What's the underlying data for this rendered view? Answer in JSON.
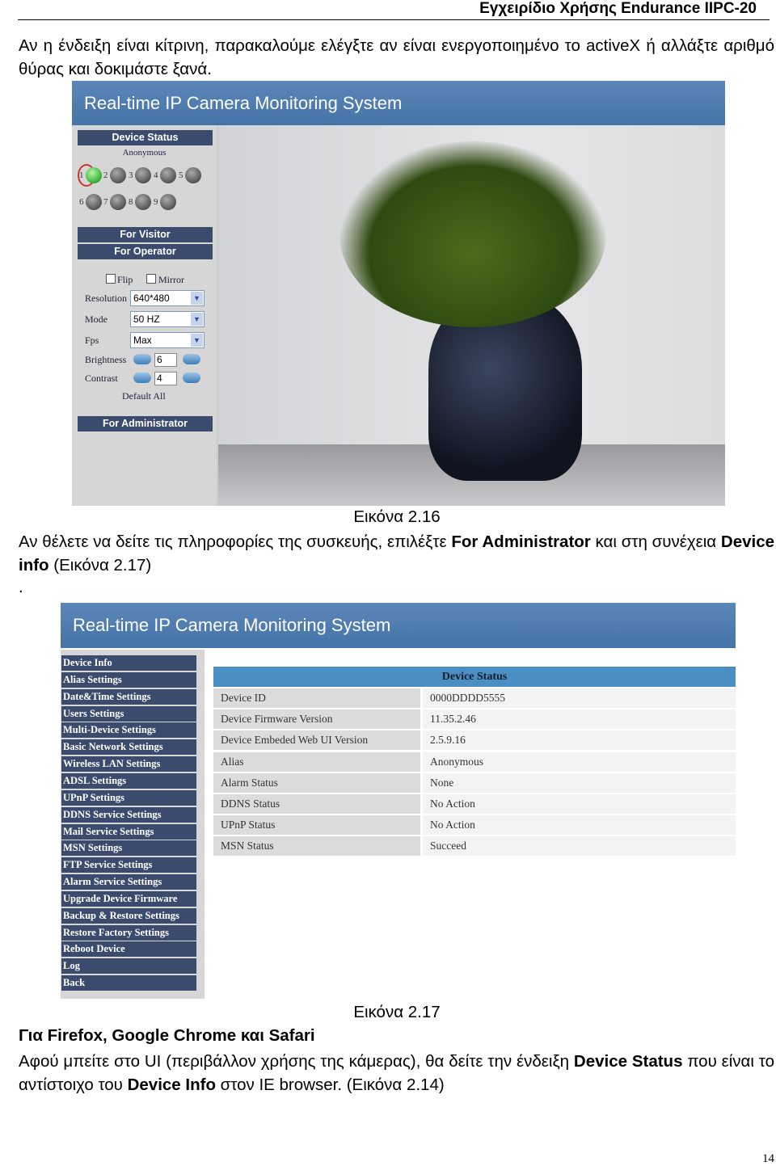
{
  "header": {
    "title": "Εγχειρίδιο Χρήσης Endurance IIPC-20"
  },
  "para1": "Αν η ένδειξη είναι κίτρινη, παρακαλούμε ελέγξτε αν είναι ενεργοποιημένο το activeX ή αλλάξτε αριθμό θύρας και δοκιμάστε ξανά.",
  "fig1": {
    "title": "Real-time IP Camera Monitoring System",
    "device_status": "Device Status",
    "user": "Anonymous",
    "leds": [
      "1",
      "2",
      "3",
      "4",
      "5",
      "6",
      "7",
      "8",
      "9"
    ],
    "active_led": "1",
    "for_visitor": "For Visitor",
    "for_operator": "For Operator",
    "flip": "Flip",
    "mirror": "Mirror",
    "resolution_label": "Resolution",
    "resolution": "640*480",
    "mode_label": "Mode",
    "mode": "50 HZ",
    "fps_label": "Fps",
    "fps": "Max",
    "brightness_label": "Brightness",
    "brightness": "6",
    "contrast_label": "Contrast",
    "contrast": "4",
    "default_all": "Default All",
    "for_administrator": "For Administrator",
    "caption": "Εικόνα 2.16"
  },
  "para2": {
    "a": "Αν θέλετε να δείτε τις πληροφορίες της συσκευής, επιλέξτε ",
    "b": "For Administrator",
    "c": " και στη συνέχεια ",
    "d": "Device info",
    "e": " (Εικόνα 2.17)",
    "dot": "."
  },
  "fig2": {
    "title": "Real-time IP Camera Monitoring System",
    "menu": [
      "Device Info",
      "Alias Settings",
      "Date&Time Settings",
      "Users Settings",
      "Multi-Device Settings",
      "Basic Network Settings",
      "Wireless LAN Settings",
      "ADSL Settings",
      "UPnP Settings",
      "DDNS Service Settings",
      "Mail Service Settings",
      "MSN Settings",
      "FTP Service Settings",
      "Alarm Service Settings",
      "Upgrade Device Firmware",
      "Backup & Restore Settings",
      "Restore Factory Settings",
      "Reboot Device",
      "Log",
      "Back"
    ],
    "table_title": "Device Status",
    "rows": [
      [
        "Device ID",
        "0000DDDD5555"
      ],
      [
        "Device Firmware Version",
        "11.35.2.46"
      ],
      [
        "Device Embeded Web UI Version",
        "2.5.9.16"
      ],
      [
        "Alias",
        "Anonymous"
      ],
      [
        "Alarm Status",
        "None"
      ],
      [
        "DDNS Status",
        "No Action"
      ],
      [
        "UPnP Status",
        "No Action"
      ],
      [
        "MSN Status",
        "Succeed"
      ]
    ],
    "caption": "Εικόνα 2.17"
  },
  "heading": "Για Firefox, Google Chrome και Safari",
  "para3": {
    "a": "Αφού μπείτε στο UI (περιβάλλον χρήσης της κάμερας), θα δείτε την ένδειξη ",
    "b": "Device Status",
    "c": " που είναι το αντίστοιχο του ",
    "d": "Device Info",
    "e": " στον IE browser. (Εικόνα 2.14)"
  },
  "page_number": "14"
}
